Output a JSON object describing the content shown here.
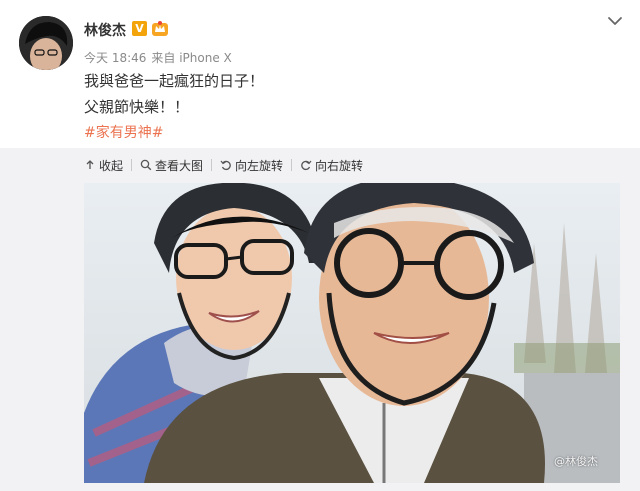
{
  "user": {
    "name": "林俊杰",
    "verified_badge": "V"
  },
  "meta": {
    "time": "今天 18:46",
    "source": "来自 iPhone X"
  },
  "post": {
    "line1": "我與爸爸一起瘋狂的日子！",
    "line2": "父親節快樂！！",
    "hashtag": "#家有男神#"
  },
  "toolbar": {
    "collapse": "收起",
    "view_large": "查看大图",
    "rotate_left": "向左旋转",
    "rotate_right": "向右旋转"
  },
  "photo": {
    "watermark": "@林俊杰"
  },
  "colors": {
    "hashtag": "#eb7350",
    "badge": "#f4a40b",
    "media_bg": "#f2f2f5"
  },
  "icons": [
    "crown-icon",
    "chevron-down-icon",
    "collapse-icon",
    "magnifier-icon",
    "rotate-left-icon",
    "rotate-right-icon"
  ]
}
